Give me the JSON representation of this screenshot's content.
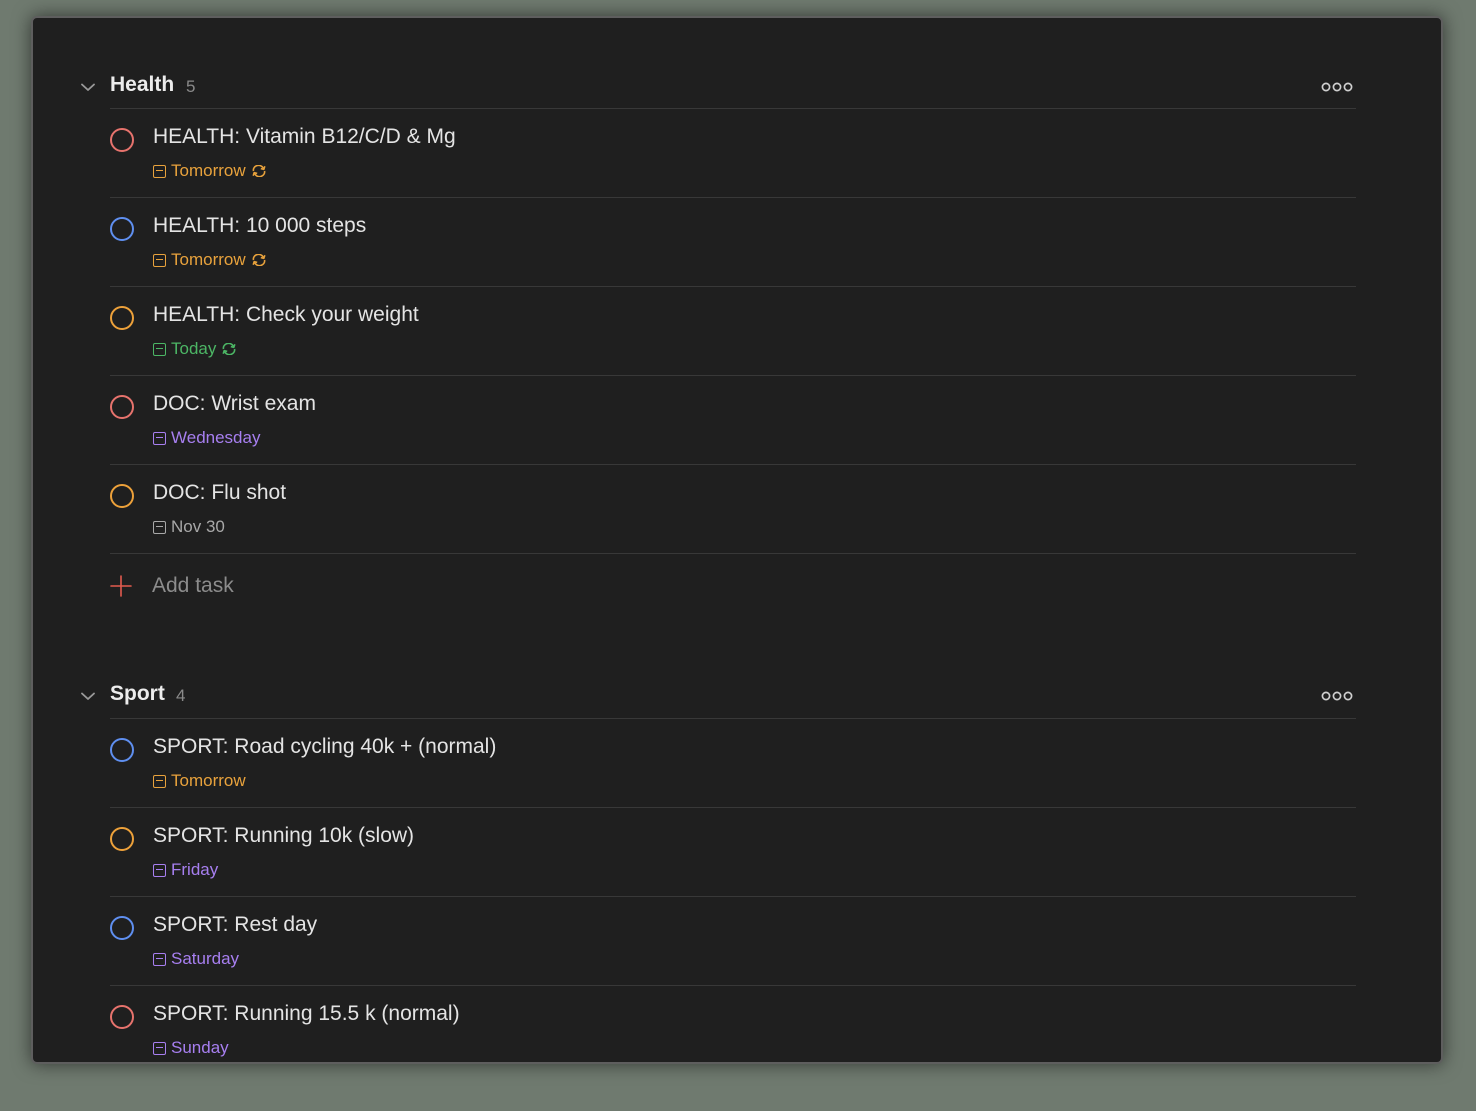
{
  "colors": {
    "p1_red": "#e7736d",
    "p2_orange": "#eda13a",
    "p3_blue": "#5f8ff0",
    "date_tomorrow": "#e8a23c",
    "date_today": "#4cb665",
    "date_weekday": "#a77ff0",
    "date_later": "#a8a8a8",
    "add_plus": "#e35b4f"
  },
  "sections": [
    {
      "title": "Health",
      "count": "5",
      "more_icon": "more-horizontal-icon",
      "collapse_icon": "chevron-down-icon",
      "tasks": [
        {
          "title": "HEALTH: Vitamin B12/C/D & Mg",
          "priority_color": "#e7736d",
          "date": "Tomorrow",
          "date_color": "#e8a23c",
          "recurring": true
        },
        {
          "title": "HEALTH: 10 000 steps",
          "priority_color": "#5f8ff0",
          "date": "Tomorrow",
          "date_color": "#e8a23c",
          "recurring": true
        },
        {
          "title": "HEALTH: Check your weight",
          "priority_color": "#eda13a",
          "date": "Today",
          "date_color": "#4cb665",
          "recurring": true
        },
        {
          "title": "DOC: Wrist exam",
          "priority_color": "#e7736d",
          "date": "Wednesday",
          "date_color": "#a77ff0",
          "recurring": false
        },
        {
          "title": "DOC: Flu shot",
          "priority_color": "#eda13a",
          "date": "Nov 30",
          "date_color": "#a8a8a8",
          "recurring": false
        }
      ],
      "add_task_label": "Add task"
    },
    {
      "title": "Sport",
      "count": "4",
      "more_icon": "more-horizontal-icon",
      "collapse_icon": "chevron-down-icon",
      "tasks": [
        {
          "title": "SPORT: Road cycling 40k + (normal)",
          "priority_color": "#5f8ff0",
          "date": "Tomorrow",
          "date_color": "#e8a23c",
          "recurring": false
        },
        {
          "title": "SPORT: Running 10k (slow)",
          "priority_color": "#eda13a",
          "date": "Friday",
          "date_color": "#a77ff0",
          "recurring": false
        },
        {
          "title": "SPORT: Rest day",
          "priority_color": "#5f8ff0",
          "date": "Saturday",
          "date_color": "#a77ff0",
          "recurring": false
        },
        {
          "title": "SPORT: Running 15.5 k (normal)",
          "priority_color": "#e7736d",
          "date": "Sunday",
          "date_color": "#a77ff0",
          "recurring": false
        }
      ]
    }
  ]
}
